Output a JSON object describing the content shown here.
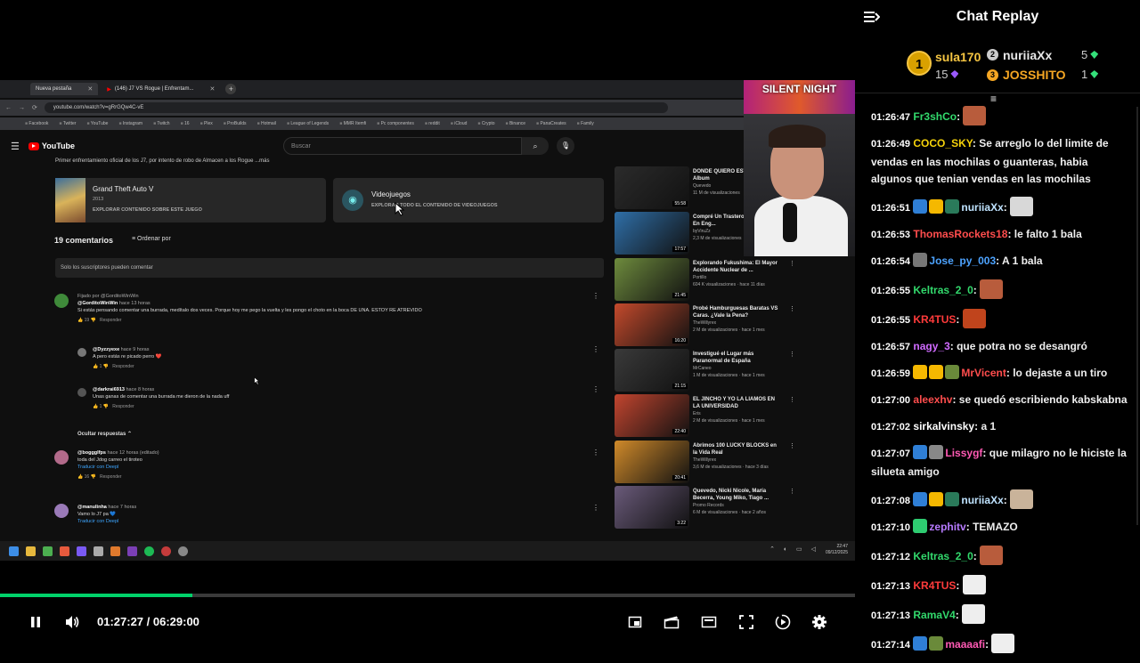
{
  "browser": {
    "tabs": [
      {
        "label": "Nueva pestaña",
        "active": true
      },
      {
        "label": "(146) J7 VS Rogue | Enfrentam...",
        "active": false
      }
    ],
    "url": "youtube.com/watch?v=gRrGQw4C-vE",
    "bookmarks": [
      "Facebook",
      "Twitter",
      "YouTube",
      "Instagram",
      "Twitch",
      "16",
      "Plex",
      "ProBuilds",
      "Hotmail",
      "League of Legends",
      "MMR Itemfi",
      "Pc componentes",
      "reddit",
      "iCloud",
      "Crypto",
      "Binance",
      "PanaCreates",
      "Family"
    ]
  },
  "youtube": {
    "logo": "YouTube",
    "search_placeholder": "Buscar",
    "description_line": "Primer enfrentamiento oficial de los J7, por intento de robo de Almacen a los Rogue ...más",
    "game_card": {
      "title": "Grand Theft Auto V",
      "year": "2013",
      "link": "EXPLORAR CONTENIDO SOBRE ESTE JUEGO"
    },
    "cat_card": {
      "title": "Videojuegos",
      "link": "EXPLORAR TODO EL CONTENIDO DE VIDEOJUEGOS"
    },
    "comments_count": "19 comentarios",
    "sort_label": "Ordenar por",
    "subscribers_only": "Solo los suscriptores pueden comentar",
    "comments": [
      {
        "pinned": "Fijado por @GorditoWinWin",
        "author": "@GorditoWinWin",
        "time": "hace 13 horas",
        "text": "Si estás pensando comentar una burrada, medítalo dos veces. Porque hoy me pego la vuelta y les pongo el choto en la boca DE UNA. ESTOY RE ATREVIDO",
        "likes": "19",
        "reply": "Responder"
      },
      {
        "author": "@Dyzzyexe",
        "time": "hace 9 horas",
        "text": "A pero estás re picado perro ❤️",
        "likes": "1",
        "reply": "Responder"
      },
      {
        "author": "@darkrai6913",
        "time": "hace 8 horas",
        "text": "Unas ganas de comentar una burrada me dieron de la nada uff",
        "likes": "1",
        "reply": "Responder"
      },
      {
        "author": "@boggglfps",
        "time": "hace 12 horas (editado)",
        "text": "toda del Jdog carreo el tiroteo",
        "translate": "Traducir con Deepl",
        "likes": "16",
        "reply": "Responder"
      },
      {
        "author": "@manulinha",
        "time": "hace 7 horas",
        "text": "Vamo lo J7 pa 💙",
        "translate": "Traducir con Deepl"
      }
    ],
    "hide_replies": "Ocultar respuestas",
    "recs": [
      {
        "title": "DONDE QUIERO ESTAR | Full Album",
        "channel": "Quevedo",
        "views": "11 M de visualizaciones",
        "dur": "55:58",
        "color": "#2b2b2b"
      },
      {
        "title": "Compré Un Trastero Abandonado En Eng...",
        "channel": "byViruZz",
        "views": "2,3 M de visualizaciones",
        "dur": "17:57",
        "color": "#2f6fa8"
      },
      {
        "title": "Explorando Fukushima: El Mayor Accidente Nuclear de ...",
        "channel": "Portillo",
        "views": "604 K visualizaciones · hace 11 días",
        "dur": "21:45",
        "color": "#6e8b3d"
      },
      {
        "title": "Probé Hamburguesas Baratas VS Caras. ¿Vale la Pena?",
        "channel": "TheWillyrex",
        "views": "2 M de visualizaciones · hace 1 mes",
        "dur": "16:20",
        "color": "#c44a2c"
      },
      {
        "title": "Investigué el Lugar más Paranormal de España",
        "channel": "MrCaneo",
        "views": "1 M de visualizaciones · hace 1 mes",
        "dur": "21:15",
        "color": "#3a3a3a"
      },
      {
        "title": "EL JINCHO Y YO LA LIAMOS EN LA UNIVERSIDAD",
        "channel": "Eris",
        "views": "2 M de visualizaciones · hace 1 mes",
        "dur": "22:40",
        "color": "#c2452f"
      },
      {
        "title": "Abrimos 100 LUCKY BLOCKS en la Vida Real",
        "channel": "TheWillyrex",
        "views": "3,6 M de visualizaciones · hace 3 días",
        "dur": "20:41",
        "color": "#d08a2a"
      },
      {
        "title": "Quevedo, Nicki Nicole, María Becerra, Young Miko, Tiago ...",
        "channel": "Promo Records",
        "views": "6 M de visualizaciones · hace 2 años",
        "dur": "3:22",
        "color": "#6a5a7a"
      }
    ],
    "clock": [
      "22:47",
      "09/12/2025"
    ]
  },
  "webcam": {
    "overlay": "SILENT NIGHT"
  },
  "player": {
    "progress": 0.225,
    "time": "01:27:27 / 06:29:00"
  },
  "chat": {
    "title": "Chat Replay",
    "leaderboard": [
      {
        "rank": "1",
        "name": "sula170",
        "points": "15"
      },
      {
        "rank": "2",
        "name": "nuriiaXx",
        "points": "5"
      },
      {
        "rank": "3",
        "name": "JOSSHITO",
        "points": "1"
      }
    ],
    "messages": [
      {
        "time": "01:26:47",
        "user": "Fr3shCo",
        "color": "#32d96c",
        "badges": [],
        "text": "",
        "emote": "#b85c3c"
      },
      {
        "time": "01:26:49",
        "user": "COCO_SKY",
        "color": "#f5d20a",
        "badges": [],
        "text": "Se arreglo lo del limite de vendas en las mochilas o guanteras, habia algunos que tenian vendas en las mochilas"
      },
      {
        "time": "01:26:51",
        "user": "nuriiaXx",
        "color": "#bfe3ff",
        "badges": [
          "#2f7fd6",
          "#f5b800",
          "#2a7a5a"
        ],
        "text": "",
        "emote": "#d8d8d8"
      },
      {
        "time": "01:26:53",
        "user": "ThomasRockets18",
        "color": "#ff4d4d",
        "badges": [],
        "text": "le falto 1 bala"
      },
      {
        "time": "01:26:54",
        "user": "Jose_py_003",
        "color": "#4da3ff",
        "badges": [
          "#777"
        ],
        "text": "A 1 bala"
      },
      {
        "time": "01:26:55",
        "user": "Keltras_2_0",
        "color": "#32d96c",
        "badges": [],
        "text": "",
        "emote": "#b85c3c"
      },
      {
        "time": "01:26:55",
        "user": "KR4TUS",
        "color": "#ff3b3b",
        "badges": [],
        "text": "",
        "emote": "#c0441c"
      },
      {
        "time": "01:26:57",
        "user": "nagy_3",
        "color": "#d06bff",
        "badges": [],
        "text": "que potra no se desangró"
      },
      {
        "time": "01:26:59",
        "user": "MrVicent",
        "color": "#ff4d4d",
        "badges": [
          "#f5b800",
          "#f5b800",
          "#6a8a3a"
        ],
        "text": "lo dejaste a un tiro"
      },
      {
        "time": "01:27:00",
        "user": "aleexhv",
        "color": "#ff4d4d",
        "badges": [],
        "text": "se quedó escribiendo kabskabna"
      },
      {
        "time": "01:27:02",
        "user": "sirkalvinsky",
        "color": "#ffffff",
        "badges": [],
        "text": "a 1"
      },
      {
        "time": "01:27:07",
        "user": "Lissygf",
        "color": "#ff5ab4",
        "badges": [
          "#2f7fd6",
          "#888"
        ],
        "text": "que milagro no le hiciste la silueta amigo"
      },
      {
        "time": "01:27:08",
        "user": "nuriiaXx",
        "color": "#bfe3ff",
        "badges": [
          "#2f7fd6",
          "#f5b800",
          "#2a7a5a"
        ],
        "text": "",
        "emote": "#c9b39a"
      },
      {
        "time": "01:27:10",
        "user": "zephitv",
        "color": "#b77bff",
        "badges": [
          "#2ecc71"
        ],
        "text": "TEMAZO"
      },
      {
        "time": "01:27:12",
        "user": "Keltras_2_0",
        "color": "#32d96c",
        "badges": [],
        "text": "",
        "emote": "#b85c3c"
      },
      {
        "time": "01:27:13",
        "user": "KR4TUS",
        "color": "#ff3b3b",
        "badges": [],
        "text": "",
        "emote": "#eeeeee"
      },
      {
        "time": "01:27:13",
        "user": "RamaV4",
        "color": "#32d96c",
        "badges": [],
        "text": "",
        "emote": "#eeeeee"
      },
      {
        "time": "01:27:14",
        "user": "maaaafi",
        "color": "#ff5ab4",
        "badges": [
          "#2f7fd6",
          "#6a8a3a"
        ],
        "text": "",
        "emote": "#eeeeee"
      }
    ]
  }
}
